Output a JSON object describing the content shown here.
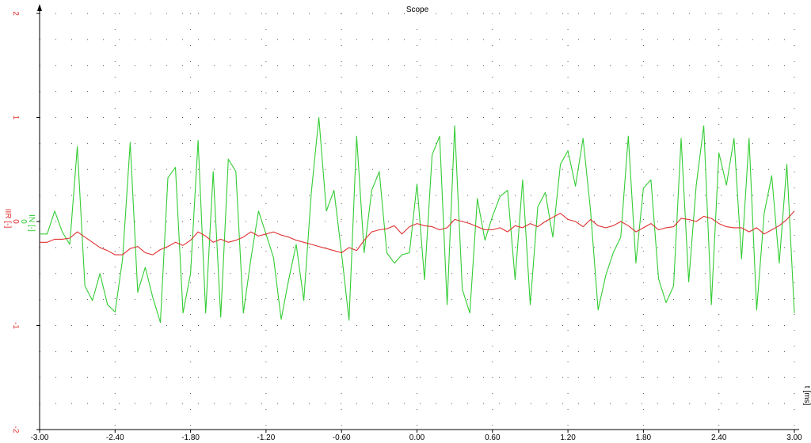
{
  "chart_data": {
    "type": "line",
    "title": "Scope",
    "xlabel": "t [ms]",
    "ylabels": [
      {
        "text": "IIR [-]",
        "color": "#e03030"
      },
      {
        "text": "IN [-]",
        "color": "#33cc33"
      }
    ],
    "xlim": [
      -3.0,
      3.0
    ],
    "ylim": [
      -2,
      2
    ],
    "xticks": [
      "-3.00",
      "-2.40",
      "-1.80",
      "-1.20",
      "-0.60",
      "0.00",
      "0.60",
      "1.20",
      "1.80",
      "2.40",
      "3.00"
    ],
    "yticks_red": [
      "-2",
      "-1",
      "0",
      "1",
      "2"
    ],
    "yticks_green": [
      "0"
    ],
    "grid": true,
    "series": [
      {
        "name": "IN",
        "color": "#33cc33",
        "points": [
          [
            -3.0,
            -0.12
          ],
          [
            -2.94,
            -0.12
          ],
          [
            -2.88,
            0.1
          ],
          [
            -2.82,
            -0.1
          ],
          [
            -2.76,
            -0.22
          ],
          [
            -2.7,
            0.72
          ],
          [
            -2.64,
            -0.62
          ],
          [
            -2.58,
            -0.76
          ],
          [
            -2.52,
            -0.5
          ],
          [
            -2.46,
            -0.8
          ],
          [
            -2.4,
            -0.87
          ],
          [
            -2.34,
            -0.36
          ],
          [
            -2.28,
            0.76
          ],
          [
            -2.22,
            -0.68
          ],
          [
            -2.16,
            -0.44
          ],
          [
            -2.1,
            -0.73
          ],
          [
            -2.04,
            -0.97
          ],
          [
            -1.98,
            0.42
          ],
          [
            -1.92,
            0.52
          ],
          [
            -1.86,
            -0.88
          ],
          [
            -1.8,
            -0.5
          ],
          [
            -1.74,
            0.78
          ],
          [
            -1.68,
            -0.88
          ],
          [
            -1.62,
            0.48
          ],
          [
            -1.56,
            -0.92
          ],
          [
            -1.5,
            0.6
          ],
          [
            -1.44,
            0.48
          ],
          [
            -1.38,
            -0.88
          ],
          [
            -1.32,
            -0.36
          ],
          [
            -1.26,
            0.1
          ],
          [
            -1.2,
            -0.12
          ],
          [
            -1.14,
            -0.35
          ],
          [
            -1.08,
            -0.94
          ],
          [
            -1.02,
            -0.56
          ],
          [
            -0.96,
            -0.22
          ],
          [
            -0.9,
            -0.76
          ],
          [
            -0.84,
            0.28
          ],
          [
            -0.78,
            1.0
          ],
          [
            -0.72,
            0.1
          ],
          [
            -0.66,
            0.3
          ],
          [
            -0.6,
            -0.3
          ],
          [
            -0.54,
            -0.95
          ],
          [
            -0.48,
            0.82
          ],
          [
            -0.42,
            -0.3
          ],
          [
            -0.36,
            0.3
          ],
          [
            -0.3,
            0.48
          ],
          [
            -0.24,
            -0.3
          ],
          [
            -0.18,
            -0.4
          ],
          [
            -0.12,
            -0.32
          ],
          [
            -0.06,
            -0.3
          ],
          [
            0.0,
            0.36
          ],
          [
            0.06,
            -0.56
          ],
          [
            0.12,
            0.64
          ],
          [
            0.18,
            0.82
          ],
          [
            0.24,
            -0.8
          ],
          [
            0.3,
            0.92
          ],
          [
            0.36,
            -0.65
          ],
          [
            0.42,
            -0.88
          ],
          [
            0.48,
            0.22
          ],
          [
            0.54,
            -0.18
          ],
          [
            0.6,
            0.05
          ],
          [
            0.66,
            0.24
          ],
          [
            0.72,
            0.3
          ],
          [
            0.78,
            -0.56
          ],
          [
            0.84,
            0.4
          ],
          [
            0.9,
            -0.8
          ],
          [
            0.96,
            0.14
          ],
          [
            1.02,
            0.28
          ],
          [
            1.08,
            -0.15
          ],
          [
            1.14,
            0.55
          ],
          [
            1.2,
            0.68
          ],
          [
            1.26,
            0.34
          ],
          [
            1.32,
            0.8
          ],
          [
            1.38,
            0.1
          ],
          [
            1.44,
            -0.85
          ],
          [
            1.5,
            -0.52
          ],
          [
            1.56,
            -0.3
          ],
          [
            1.62,
            -0.15
          ],
          [
            1.68,
            0.82
          ],
          [
            1.74,
            -0.4
          ],
          [
            1.8,
            0.32
          ],
          [
            1.86,
            0.4
          ],
          [
            1.92,
            -0.55
          ],
          [
            1.98,
            -0.78
          ],
          [
            2.04,
            -0.62
          ],
          [
            2.1,
            0.8
          ],
          [
            2.16,
            -0.58
          ],
          [
            2.22,
            0.35
          ],
          [
            2.28,
            0.92
          ],
          [
            2.34,
            -0.8
          ],
          [
            2.4,
            0.66
          ],
          [
            2.46,
            0.35
          ],
          [
            2.52,
            0.8
          ],
          [
            2.58,
            -0.36
          ],
          [
            2.64,
            0.8
          ],
          [
            2.7,
            -0.85
          ],
          [
            2.76,
            0.08
          ],
          [
            2.82,
            0.44
          ],
          [
            2.88,
            -0.4
          ],
          [
            2.94,
            0.55
          ],
          [
            3.0,
            -0.88
          ]
        ]
      },
      {
        "name": "IIR",
        "color": "#e03030",
        "points": [
          [
            -3.0,
            -0.2
          ],
          [
            -2.94,
            -0.2
          ],
          [
            -2.88,
            -0.17
          ],
          [
            -2.82,
            -0.17
          ],
          [
            -2.76,
            -0.16
          ],
          [
            -2.7,
            -0.1
          ],
          [
            -2.64,
            -0.15
          ],
          [
            -2.58,
            -0.2
          ],
          [
            -2.52,
            -0.25
          ],
          [
            -2.46,
            -0.28
          ],
          [
            -2.4,
            -0.32
          ],
          [
            -2.34,
            -0.32
          ],
          [
            -2.28,
            -0.26
          ],
          [
            -2.22,
            -0.24
          ],
          [
            -2.16,
            -0.3
          ],
          [
            -2.1,
            -0.32
          ],
          [
            -2.04,
            -0.27
          ],
          [
            -1.98,
            -0.24
          ],
          [
            -1.92,
            -0.2
          ],
          [
            -1.86,
            -0.23
          ],
          [
            -1.8,
            -0.18
          ],
          [
            -1.74,
            -0.1
          ],
          [
            -1.68,
            -0.14
          ],
          [
            -1.62,
            -0.2
          ],
          [
            -1.56,
            -0.17
          ],
          [
            -1.5,
            -0.2
          ],
          [
            -1.44,
            -0.18
          ],
          [
            -1.38,
            -0.15
          ],
          [
            -1.32,
            -0.1
          ],
          [
            -1.26,
            -0.14
          ],
          [
            -1.2,
            -0.12
          ],
          [
            -1.14,
            -0.1
          ],
          [
            -1.08,
            -0.13
          ],
          [
            -1.02,
            -0.15
          ],
          [
            -0.96,
            -0.18
          ],
          [
            -0.9,
            -0.2
          ],
          [
            -0.84,
            -0.22
          ],
          [
            -0.78,
            -0.24
          ],
          [
            -0.72,
            -0.26
          ],
          [
            -0.66,
            -0.28
          ],
          [
            -0.6,
            -0.3
          ],
          [
            -0.54,
            -0.25
          ],
          [
            -0.48,
            -0.28
          ],
          [
            -0.42,
            -0.18
          ],
          [
            -0.36,
            -0.1
          ],
          [
            -0.3,
            -0.08
          ],
          [
            -0.24,
            -0.07
          ],
          [
            -0.18,
            -0.04
          ],
          [
            -0.12,
            -0.12
          ],
          [
            -0.06,
            -0.05
          ],
          [
            0.0,
            -0.02
          ],
          [
            0.06,
            -0.04
          ],
          [
            0.12,
            -0.05
          ],
          [
            0.18,
            -0.08
          ],
          [
            0.24,
            -0.06
          ],
          [
            0.3,
            0.02
          ],
          [
            0.36,
            0.0
          ],
          [
            0.42,
            -0.02
          ],
          [
            0.48,
            -0.05
          ],
          [
            0.54,
            -0.08
          ],
          [
            0.6,
            -0.08
          ],
          [
            0.66,
            -0.06
          ],
          [
            0.72,
            -0.1
          ],
          [
            0.78,
            -0.04
          ],
          [
            0.84,
            -0.06
          ],
          [
            0.9,
            -0.02
          ],
          [
            0.96,
            -0.05
          ],
          [
            1.02,
            0.0
          ],
          [
            1.08,
            0.04
          ],
          [
            1.14,
            0.08
          ],
          [
            1.2,
            0.02
          ],
          [
            1.26,
            0.0
          ],
          [
            1.32,
            -0.05
          ],
          [
            1.38,
            0.02
          ],
          [
            1.44,
            -0.04
          ],
          [
            1.5,
            -0.06
          ],
          [
            1.56,
            -0.04
          ],
          [
            1.62,
            0.0
          ],
          [
            1.68,
            -0.04
          ],
          [
            1.74,
            -0.1
          ],
          [
            1.8,
            -0.06
          ],
          [
            1.86,
            -0.02
          ],
          [
            1.92,
            -0.08
          ],
          [
            1.98,
            -0.06
          ],
          [
            2.04,
            -0.05
          ],
          [
            2.1,
            0.03
          ],
          [
            2.16,
            0.02
          ],
          [
            2.22,
            0.0
          ],
          [
            2.28,
            0.05
          ],
          [
            2.34,
            0.03
          ],
          [
            2.4,
            -0.02
          ],
          [
            2.46,
            -0.05
          ],
          [
            2.52,
            -0.06
          ],
          [
            2.58,
            -0.06
          ],
          [
            2.64,
            -0.1
          ],
          [
            2.7,
            -0.06
          ],
          [
            2.76,
            -0.12
          ],
          [
            2.82,
            -0.08
          ],
          [
            2.88,
            -0.04
          ],
          [
            2.94,
            0.02
          ],
          [
            3.0,
            0.1
          ]
        ]
      }
    ]
  }
}
